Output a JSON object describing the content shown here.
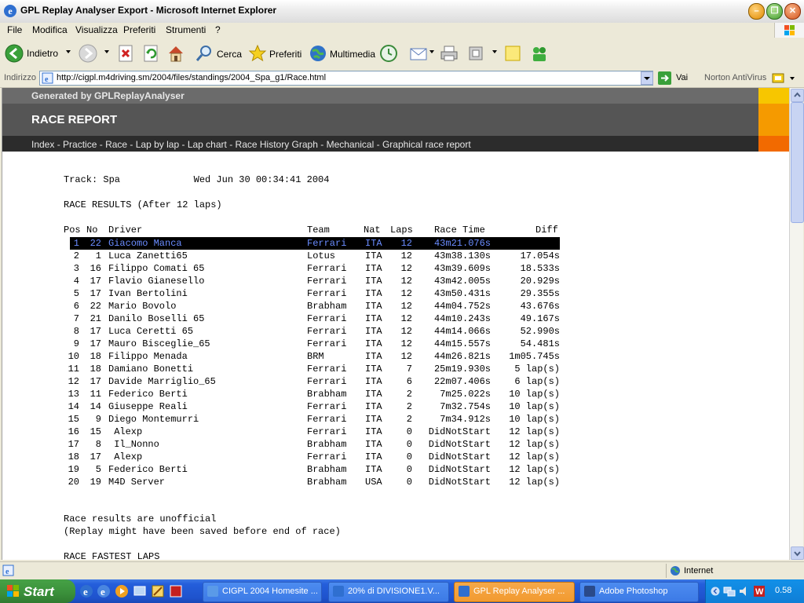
{
  "window": {
    "title": "GPL Replay Analyser Export - Microsoft Internet Explorer"
  },
  "menu": [
    "File",
    "Modifica",
    "Visualizza",
    "Preferiti",
    "Strumenti",
    "?"
  ],
  "toolbar": {
    "back": "Indietro",
    "search": "Cerca",
    "favorites": "Preferiti",
    "media": "Multimedia"
  },
  "address": {
    "label": "Indirizzo",
    "url": "http://cigpl.m4driving.sm/2004/files/standings/2004_Spa_g1/Race.html",
    "go": "Vai",
    "antivirus": "Norton AntiVirus"
  },
  "page": {
    "generated": "Generated by GPLReplayAnalyser",
    "report_title": "RACE REPORT",
    "nav": [
      "Index",
      "Practice",
      "Race",
      "Lap by lap",
      "Lap chart",
      "Race History Graph",
      "Mechanical",
      "Graphical race report"
    ],
    "nav_sep": " - ",
    "track_line": "Track: Spa             Wed Jun 30 00:34:41 2004",
    "results_heading": "RACE RESULTS (After 12 laps)",
    "headers": {
      "pos": "Pos",
      "no": "No",
      "driver": "Driver",
      "team": "Team",
      "nat": "Nat",
      "laps": "Laps",
      "time": "Race Time",
      "diff": "Diff"
    },
    "results": [
      {
        "pos": "1",
        "no": "22",
        "driver": "Giacomo Manca",
        "team": "Ferrari",
        "nat": "ITA",
        "laps": "12",
        "time": "43m21.076s",
        "diff": ""
      },
      {
        "pos": "2",
        "no": "1",
        "driver": "Luca Zanetti65",
        "team": "Lotus",
        "nat": "ITA",
        "laps": "12",
        "time": "43m38.130s",
        "diff": "17.054s"
      },
      {
        "pos": "3",
        "no": "16",
        "driver": "Filippo Comati 65",
        "team": "Ferrari",
        "nat": "ITA",
        "laps": "12",
        "time": "43m39.609s",
        "diff": "18.533s"
      },
      {
        "pos": "4",
        "no": "17",
        "driver": "Flavio Gianesello",
        "team": "Ferrari",
        "nat": "ITA",
        "laps": "12",
        "time": "43m42.005s",
        "diff": "20.929s"
      },
      {
        "pos": "5",
        "no": "17",
        "driver": "Ivan Bertolini",
        "team": "Ferrari",
        "nat": "ITA",
        "laps": "12",
        "time": "43m50.431s",
        "diff": "29.355s"
      },
      {
        "pos": "6",
        "no": "22",
        "driver": "Mario Bovolo",
        "team": "Brabham",
        "nat": "ITA",
        "laps": "12",
        "time": "44m04.752s",
        "diff": "43.676s"
      },
      {
        "pos": "7",
        "no": "21",
        "driver": "Danilo Boselli 65",
        "team": "Ferrari",
        "nat": "ITA",
        "laps": "12",
        "time": "44m10.243s",
        "diff": "49.167s"
      },
      {
        "pos": "8",
        "no": "17",
        "driver": "Luca Ceretti 65",
        "team": "Ferrari",
        "nat": "ITA",
        "laps": "12",
        "time": "44m14.066s",
        "diff": "52.990s"
      },
      {
        "pos": "9",
        "no": "17",
        "driver": "Mauro Bisceglie_65",
        "team": "Ferrari",
        "nat": "ITA",
        "laps": "12",
        "time": "44m15.557s",
        "diff": "54.481s"
      },
      {
        "pos": "10",
        "no": "18",
        "driver": "Filippo Menada",
        "team": "BRM",
        "nat": "ITA",
        "laps": "12",
        "time": "44m26.821s",
        "diff": "1m05.745s"
      },
      {
        "pos": "11",
        "no": "18",
        "driver": "Damiano Bonetti",
        "team": "Ferrari",
        "nat": "ITA",
        "laps": "7",
        "time": "25m19.930s",
        "diff": "5 lap(s)"
      },
      {
        "pos": "12",
        "no": "17",
        "driver": "Davide Marriglio_65",
        "team": "Ferrari",
        "nat": "ITA",
        "laps": "6",
        "time": "22m07.406s",
        "diff": "6 lap(s)"
      },
      {
        "pos": "13",
        "no": "11",
        "driver": "Federico Berti",
        "team": "Brabham",
        "nat": "ITA",
        "laps": "2",
        "time": "7m25.022s",
        "diff": "10 lap(s)"
      },
      {
        "pos": "14",
        "no": "14",
        "driver": "Giuseppe Reali",
        "team": "Ferrari",
        "nat": "ITA",
        "laps": "2",
        "time": "7m32.754s",
        "diff": "10 lap(s)"
      },
      {
        "pos": "15",
        "no": "9",
        "driver": "Diego Montemurri",
        "team": "Ferrari",
        "nat": "ITA",
        "laps": "2",
        "time": "7m34.912s",
        "diff": "10 lap(s)"
      },
      {
        "pos": "16",
        "no": "15",
        "driver": " Alexp",
        "team": "Ferrari",
        "nat": "ITA",
        "laps": "0",
        "time": "DidNotStart",
        "diff": "12 lap(s)"
      },
      {
        "pos": "17",
        "no": "8",
        "driver": " Il_Nonno",
        "team": "Brabham",
        "nat": "ITA",
        "laps": "0",
        "time": "DidNotStart",
        "diff": "12 lap(s)"
      },
      {
        "pos": "18",
        "no": "17",
        "driver": " Alexp",
        "team": "Ferrari",
        "nat": "ITA",
        "laps": "0",
        "time": "DidNotStart",
        "diff": "12 lap(s)"
      },
      {
        "pos": "19",
        "no": "5",
        "driver": "Federico Berti",
        "team": "Brabham",
        "nat": "ITA",
        "laps": "0",
        "time": "DidNotStart",
        "diff": "12 lap(s)"
      },
      {
        "pos": "20",
        "no": "19",
        "driver": "M4D Server",
        "team": "Brabham",
        "nat": "USA",
        "laps": "0",
        "time": "DidNotStart",
        "diff": "12 lap(s)"
      }
    ],
    "note1": "Race results are unofficial",
    "note2": "(Replay might have been saved before end of race)",
    "fastest_heading": "RACE FASTEST LAPS"
  },
  "status": {
    "zone": "Internet"
  },
  "taskbar": {
    "start": "Start",
    "tasks": [
      "CIGPL 2004 Homesite ...",
      "20% di DIVISIONE1.V...",
      "GPL Replay Analyser ...",
      "Adobe Photoshop"
    ],
    "clock": "0.58"
  },
  "colors": {
    "header_dark": "#2c2c2c",
    "header_mid": "#555555",
    "accent_yellow": "#f7c600",
    "accent_orange": "#f59a00",
    "accent_red": "#f26a00",
    "highlight_text": "#6a8cff"
  }
}
